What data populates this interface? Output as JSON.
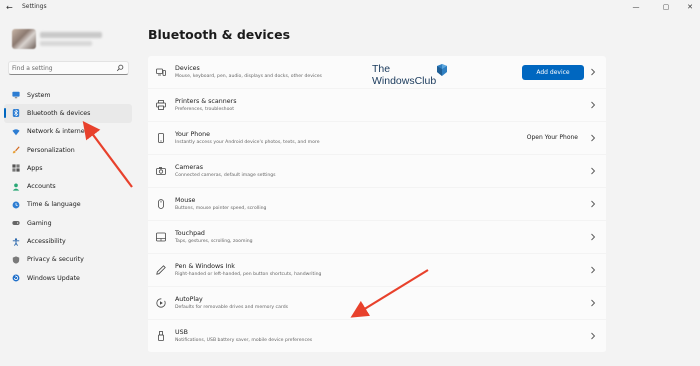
{
  "window": {
    "title": "Settings",
    "back_glyph": "←",
    "minimize_glyph": "—",
    "maximize_glyph": "▢",
    "close_glyph": "✕"
  },
  "search": {
    "placeholder": "Find a setting"
  },
  "sidebar": {
    "items": [
      {
        "label": "System",
        "icon": "monitor-icon"
      },
      {
        "label": "Bluetooth & devices",
        "icon": "bluetooth-icon",
        "active": true
      },
      {
        "label": "Network & internet",
        "icon": "wifi-icon"
      },
      {
        "label": "Personalization",
        "icon": "brush-icon"
      },
      {
        "label": "Apps",
        "icon": "apps-icon"
      },
      {
        "label": "Accounts",
        "icon": "person-icon"
      },
      {
        "label": "Time & language",
        "icon": "globe-clock-icon"
      },
      {
        "label": "Gaming",
        "icon": "gamepad-icon"
      },
      {
        "label": "Accessibility",
        "icon": "accessibility-icon"
      },
      {
        "label": "Privacy & security",
        "icon": "shield-icon"
      },
      {
        "label": "Windows Update",
        "icon": "update-icon"
      }
    ]
  },
  "main": {
    "title": "Bluetooth & devices",
    "rows": [
      {
        "title": "Devices",
        "subtitle": "Mouse, keyboard, pen, audio, displays and docks, other devices",
        "icon": "devices-icon",
        "action": "Add device"
      },
      {
        "title": "Printers & scanners",
        "subtitle": "Preferences, troubleshoot",
        "icon": "printer-icon"
      },
      {
        "title": "Your Phone",
        "subtitle": "Instantly access your Android device's photos, texts, and more",
        "icon": "phone-icon",
        "action": "Open Your Phone"
      },
      {
        "title": "Cameras",
        "subtitle": "Connected cameras, default image settings",
        "icon": "camera-icon"
      },
      {
        "title": "Mouse",
        "subtitle": "Buttons, mouse pointer speed, scrolling",
        "icon": "mouse-icon"
      },
      {
        "title": "Touchpad",
        "subtitle": "Taps, gestures, scrolling, zooming",
        "icon": "touchpad-icon"
      },
      {
        "title": "Pen & Windows Ink",
        "subtitle": "Right-handed or left-handed, pen button shortcuts, handwriting",
        "icon": "pen-icon"
      },
      {
        "title": "AutoPlay",
        "subtitle": "Defaults for removable drives and memory cards",
        "icon": "autoplay-icon"
      },
      {
        "title": "USB",
        "subtitle": "Notifications, USB battery saver, mobile device preferences",
        "icon": "usb-icon"
      }
    ]
  },
  "watermark": {
    "line1": "The",
    "line2": "WindowsClub"
  },
  "colors": {
    "accent": "#0067c0",
    "arrow": "#e8412c",
    "background": "#f3f3f3",
    "card": "#fbfbfb"
  }
}
